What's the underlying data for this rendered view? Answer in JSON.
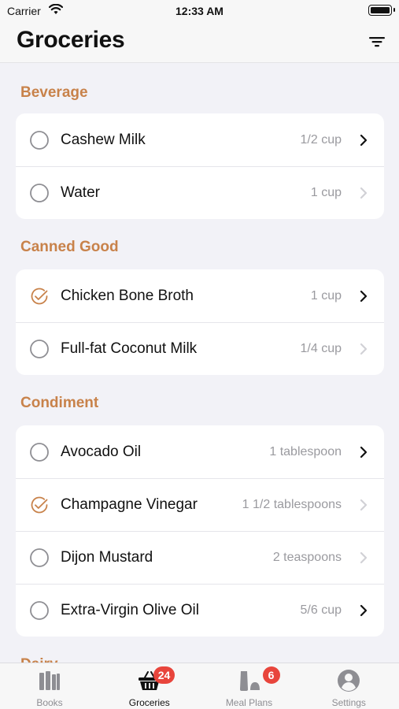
{
  "status_bar": {
    "carrier": "Carrier",
    "time": "12:33 AM"
  },
  "nav": {
    "title": "Groceries",
    "filter_icon": "filter-icon"
  },
  "sections": [
    {
      "title": "Beverage",
      "items": [
        {
          "name": "Cashew Milk",
          "qty": "1/2 cup",
          "checked": false,
          "chevron": "dark"
        },
        {
          "name": "Water",
          "qty": "1 cup",
          "checked": false,
          "chevron": "light"
        }
      ]
    },
    {
      "title": "Canned Good",
      "items": [
        {
          "name": "Chicken Bone Broth",
          "qty": "1 cup",
          "checked": true,
          "chevron": "dark"
        },
        {
          "name": "Full-fat Coconut Milk",
          "qty": "1/4 cup",
          "checked": false,
          "chevron": "light"
        }
      ]
    },
    {
      "title": "Condiment",
      "items": [
        {
          "name": "Avocado Oil",
          "qty": "1 tablespoon",
          "checked": false,
          "chevron": "dark"
        },
        {
          "name": "Champagne Vinegar",
          "qty": "1 1/2 tablespoons",
          "checked": true,
          "chevron": "light"
        },
        {
          "name": "Dijon Mustard",
          "qty": "2 teaspoons",
          "checked": false,
          "chevron": "light"
        },
        {
          "name": "Extra-Virgin Olive Oil",
          "qty": "5/6 cup",
          "checked": false,
          "chevron": "dark"
        }
      ]
    },
    {
      "title": "Dairy",
      "items": []
    }
  ],
  "tabs": [
    {
      "label": "Books",
      "icon": "books-icon",
      "badge": "",
      "active": false
    },
    {
      "label": "Groceries",
      "icon": "basket-icon",
      "badge": "24",
      "active": true
    },
    {
      "label": "Meal Plans",
      "icon": "meal-plans-icon",
      "badge": "6",
      "active": false
    },
    {
      "label": "Settings",
      "icon": "settings-icon",
      "badge": "",
      "active": false
    }
  ],
  "colors": {
    "accent": "#c8824a",
    "badge": "#e8453c",
    "checkbox": "#8e8e93"
  }
}
